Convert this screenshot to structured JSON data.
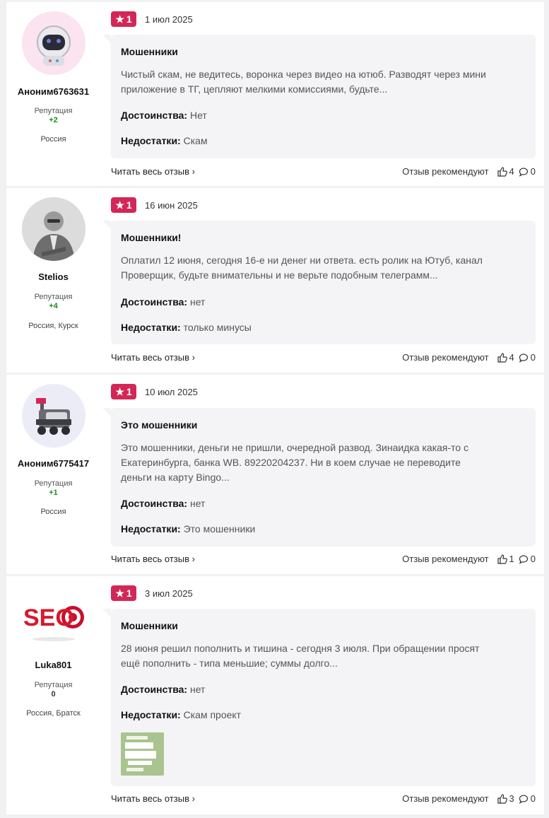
{
  "common": {
    "rep_label": "Репутация",
    "read_all": "Читать весь отзыв",
    "recommend_label": "Отзыв рекомендуют",
    "pros_label": "Достоинства:",
    "cons_label": "Недостатки:",
    "colors": {
      "rating_bg": "#d22757",
      "rep_positive": "#1a8f1a",
      "rep_neutral": "#333333"
    }
  },
  "reviews": [
    {
      "username": "Аноним6763631",
      "reputation": "+2",
      "location": "Россия",
      "avatar_icon": "astronaut-avatar-icon",
      "rating": "1",
      "date": "1 июл 2025",
      "title": "Мошенники",
      "text_lines": [
        "Чистый скам, не ведитесь, воронка через видео на ютюб. Разводят через мини",
        "приложение в ТГ, цепляют мелкими комиссиями, будьте..."
      ],
      "pros": "Нет",
      "cons": "Скам",
      "likes": "4",
      "comments": "0"
    },
    {
      "username": "Stelios",
      "reputation": "+4",
      "location": "Россия, Курск",
      "avatar_icon": "user-photo-avatar",
      "rating": "1",
      "date": "16 июн 2025",
      "title": "Мошенники!",
      "text_lines": [
        "Оплатил 12 июня, сегодня 16-е ни денег ни ответа. есть ролик на Ютуб, канал",
        "Проверщик, будьте внимательны и не верьте подобным телеграмм..."
      ],
      "pros": "нет",
      "cons": "только минусы",
      "likes": "4",
      "comments": "0"
    },
    {
      "username": "Аноним6775417",
      "reputation": "+1",
      "location": "Россия",
      "avatar_icon": "delivery-robot-avatar-icon",
      "rating": "1",
      "date": "10 июл 2025",
      "title": "Это мошенники",
      "text_lines": [
        "Это мошенники, деньги не пришли, очередной развод. Зинаидка какая-то с",
        "Екатеринбурга, банка WB. 89220204237. Ни в коем случае не переводите",
        "деньги на карту Bingo..."
      ],
      "pros": "нет",
      "cons": "Это мошенники",
      "likes": "1",
      "comments": "0"
    },
    {
      "username": "Luka801",
      "reputation": "0",
      "location": "Россия, Братск",
      "avatar_icon": "seo-logo-avatar",
      "avatar_text": "SEO",
      "rating": "1",
      "date": "3 июл 2025",
      "title": "Мошенники",
      "text_lines": [
        "28 июня решил пополнить и тишина - сегодня 3 июля. При обращении просят",
        "ещё пополнить - типа меньшие; суммы долго..."
      ],
      "pros": "нет",
      "cons": "Скам проект",
      "likes": "3",
      "comments": "0"
    }
  ]
}
